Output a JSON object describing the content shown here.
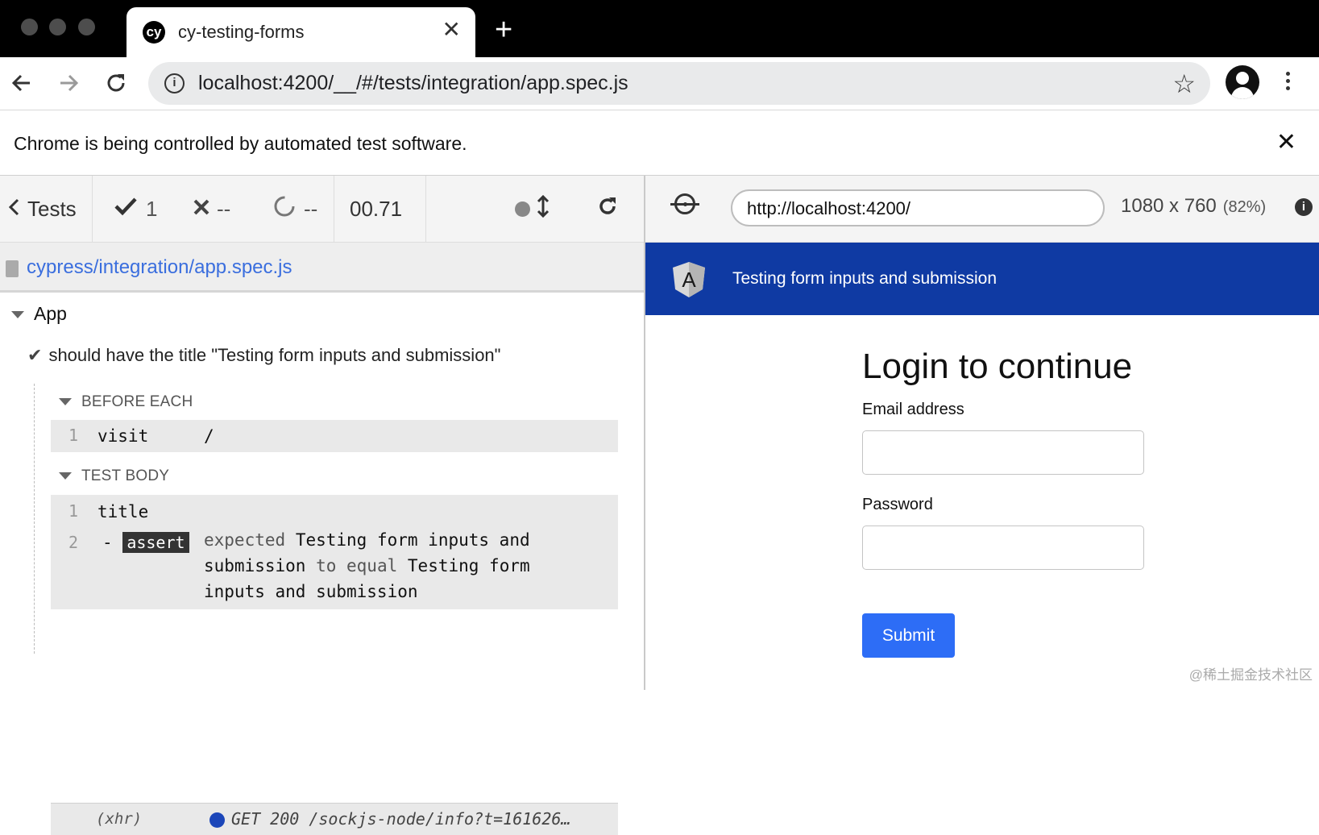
{
  "browser": {
    "tab": {
      "favicon_text": "cy",
      "title": "cy-testing-forms",
      "close_glyph": "✕"
    },
    "new_tab_glyph": "+",
    "address": {
      "url": "localhost:4200/__/#/tests/integration/app.spec.js"
    },
    "infobar": {
      "text": "Chrome is being controlled by automated test software.",
      "close_glyph": "✕"
    },
    "icons": [
      "back-icon",
      "forward-icon",
      "reload-icon",
      "info-icon",
      "star-icon",
      "profile-icon",
      "more-icon"
    ]
  },
  "reporter": {
    "tests_label": "Tests",
    "passed": "1",
    "failed": "--",
    "pending": "--",
    "duration": "00.71",
    "spec_path": "cypress/integration/app.spec.js",
    "suite": "App",
    "test_title": "should have the title \"Testing form inputs and submission\"",
    "before_each": {
      "label": "BEFORE EACH",
      "commands": [
        {
          "num": "1",
          "name": "visit",
          "message": "/"
        }
      ]
    },
    "test_body": {
      "label": "TEST BODY",
      "commands": [
        {
          "num": "1",
          "name": "title"
        },
        {
          "num": "2",
          "prefix": "-",
          "badge": "assert",
          "w1": "expected",
          "v1": "Testing form inputs and submission",
          "w2": "to equal",
          "v2": "Testing form inputs and submission"
        }
      ],
      "xhr": {
        "label": "(xhr)",
        "message": "GET 200 /sockjs-node/info?t=161626…"
      }
    }
  },
  "aut": {
    "url": "http://localhost:4200/",
    "viewport": "1080 x 760",
    "scale": "(82%)",
    "info_glyph": "i",
    "app_logo_letter": "A",
    "app_title": "Testing form inputs and submission",
    "login_title": "Login to continue",
    "email_label": "Email address",
    "password_label": "Password",
    "submit_label": "Submit"
  },
  "watermark": "@稀土掘金技术社区",
  "colors": {
    "nav_blue": "#0f3aa3",
    "submit_blue": "#2d6df6",
    "link_blue": "#3a6ede"
  }
}
